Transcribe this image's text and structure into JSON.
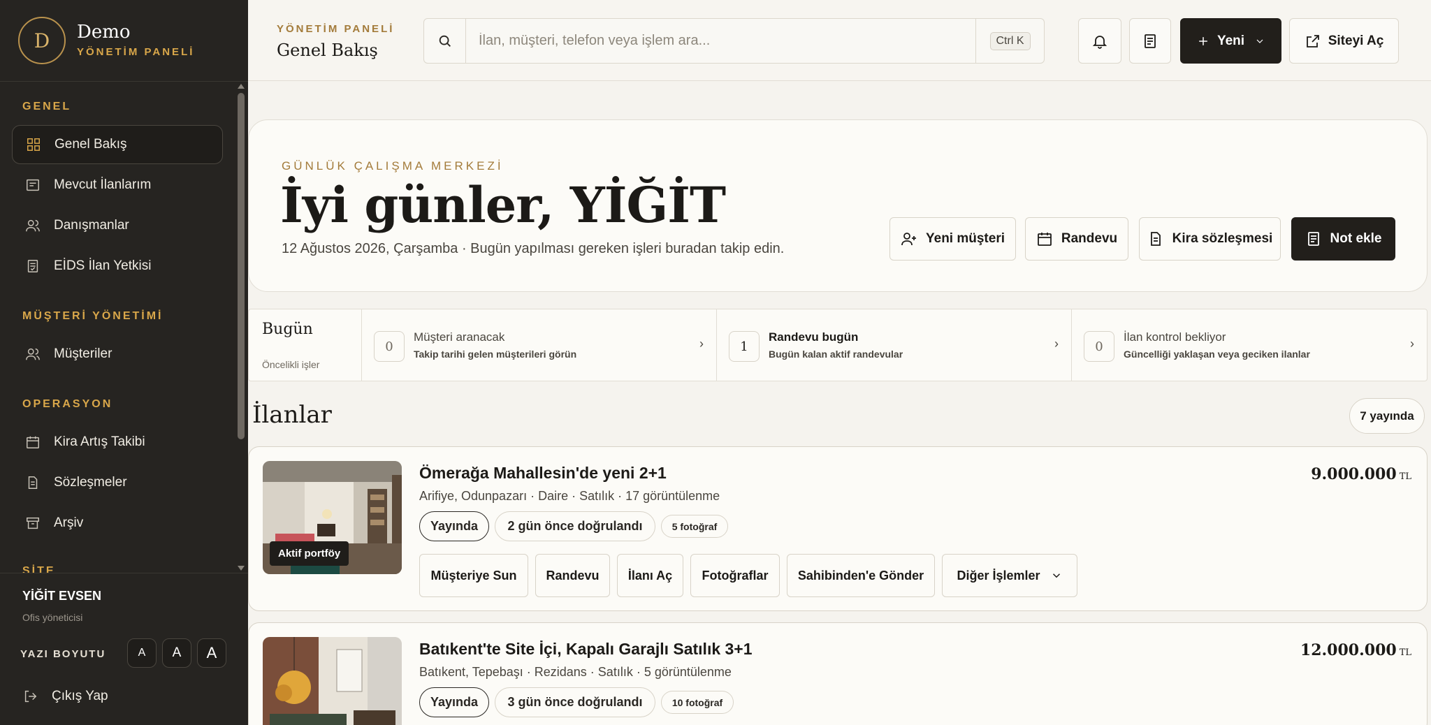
{
  "brand": {
    "initial": "D",
    "name": "Demo",
    "subtitle": "YÖNETİM PANELİ"
  },
  "sidebar": {
    "sections": [
      {
        "label": "GENEL"
      },
      {
        "label": "MÜŞTERİ YÖNETİMİ"
      },
      {
        "label": "OPERASYON"
      },
      {
        "label": "SİTE"
      }
    ],
    "items": [
      {
        "label": "Genel Bakış",
        "icon": "grid-icon",
        "active": true
      },
      {
        "label": "Mevcut İlanlarım",
        "icon": "listing-icon"
      },
      {
        "label": "Danışmanlar",
        "icon": "users-icon"
      },
      {
        "label": "EİDS İlan Yetkisi",
        "icon": "document-check-icon"
      },
      {
        "label": "Müşteriler",
        "icon": "users-icon"
      },
      {
        "label": "Kira Artış Takibi",
        "icon": "calendar-icon"
      },
      {
        "label": "Sözleşmeler",
        "icon": "document-icon"
      },
      {
        "label": "Arşiv",
        "icon": "archive-icon"
      }
    ],
    "user": {
      "name": "YİĞİT EVSEN",
      "role": "Ofis yöneticisi"
    },
    "font_size": {
      "label": "YAZI BOYUTU",
      "options": [
        "A",
        "A",
        "A"
      ]
    },
    "logout": "Çıkış Yap"
  },
  "header": {
    "kicker": "YÖNETİM PANELİ",
    "title": "Genel Bakış",
    "search": {
      "placeholder": "İlan, müşteri, telefon veya işlem ara...",
      "shortcut": "Ctrl K"
    },
    "new_button": "Yeni",
    "site_button": "Siteyi Aç"
  },
  "hero": {
    "kicker": "GÜNLÜK ÇALIŞMA MERKEZİ",
    "greeting": "İyi günler, YİĞİT",
    "subtitle": "12 Ağustos 2026, Çarşamba · Bugün yapılması gereken işleri buradan takip edin.",
    "actions": [
      "Yeni müşteri",
      "Randevu",
      "Kira sözleşmesi",
      "Not ekle"
    ]
  },
  "today": {
    "title": "Bugün",
    "subtitle": "Öncelikli işler",
    "cells": [
      {
        "count": "0",
        "title": "Müşteri aranacak",
        "desc": "Takip tarihi gelen müşterileri görün"
      },
      {
        "count": "1",
        "title": "Randevu bugün",
        "desc": "Bugün kalan aktif randevular"
      },
      {
        "count": "0",
        "title": "İlan kontrol bekliyor",
        "desc": "Güncelliği yaklaşan veya geciken ilanlar"
      }
    ]
  },
  "listings": {
    "title": "İlanlar",
    "published_badge": "7 yayında",
    "items": [
      {
        "title": "Ömerağa Mahallesin'de yeni 2+1",
        "meta": "Arifiye, Odunpazarı · Daire · Satılık · 17 görüntülenme",
        "price": "9.000.000",
        "currency": "TL",
        "status": "Yayında",
        "verified": "2 gün önce doğrulandı",
        "photos": "5 fotoğraf",
        "tag": "Aktif portföy",
        "actions": [
          "Müşteriye Sun",
          "Randevu",
          "İlanı Aç",
          "Fotoğraflar",
          "Sahibinden'e Gönder",
          "Diğer İşlemler"
        ]
      },
      {
        "title": "Batıkent'te Site İçi, Kapalı Garajlı Satılık 3+1",
        "meta": "Batıkent, Tepebaşı · Rezidans · Satılık · 5 görüntülenme",
        "price": "12.000.000",
        "currency": "TL",
        "status": "Yayında",
        "verified": "3 gün önce doğrulandı",
        "photos": "10 fotoğraf"
      }
    ]
  }
}
